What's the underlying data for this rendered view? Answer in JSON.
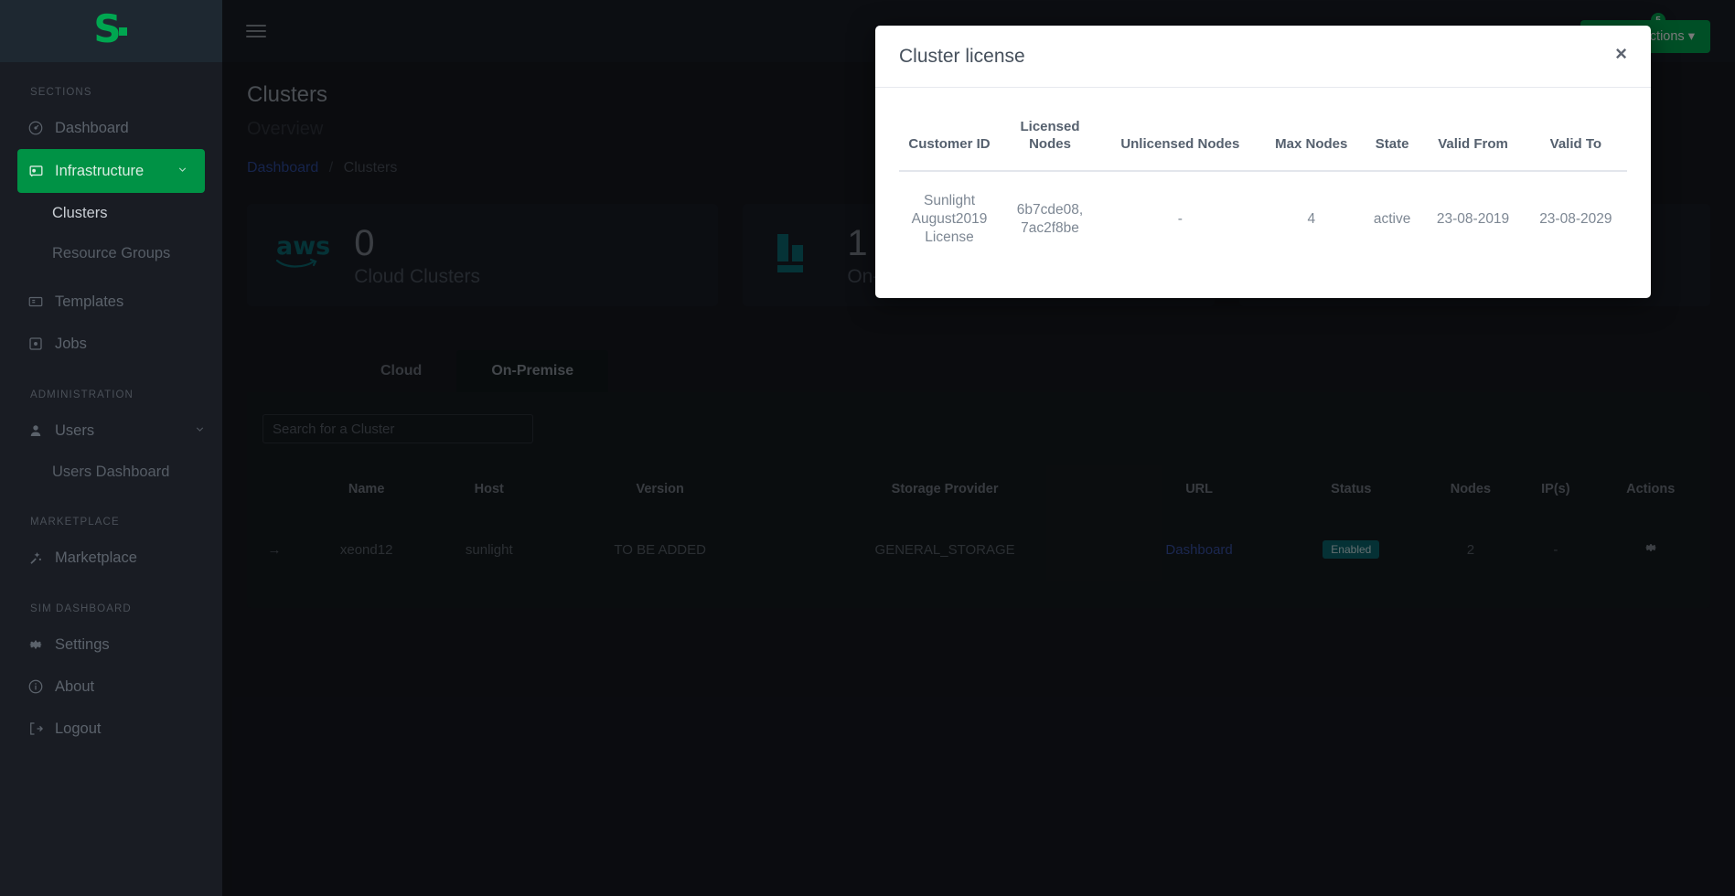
{
  "sidebar": {
    "logo": "S",
    "groups": [
      {
        "label": "SECTIONS",
        "items": [
          {
            "label": "Dashboard",
            "icon": "gauge-icon",
            "active": false,
            "children": []
          },
          {
            "label": "Infrastructure",
            "icon": "infrastructure-icon",
            "active": true,
            "children": [
              {
                "label": "Clusters",
                "current": true
              },
              {
                "label": "Resource Groups",
                "current": false
              }
            ]
          },
          {
            "label": "Templates",
            "icon": "template-icon",
            "active": false,
            "children": []
          },
          {
            "label": "Jobs",
            "icon": "jobs-icon",
            "active": false,
            "children": []
          }
        ]
      },
      {
        "label": "ADMINISTRATION",
        "items": [
          {
            "label": "Users",
            "icon": "user-icon",
            "active": false,
            "children": [
              {
                "label": "Users Dashboard",
                "current": false
              }
            ]
          }
        ]
      },
      {
        "label": "MARKETPLACE",
        "items": [
          {
            "label": "Marketplace",
            "icon": "wand-icon",
            "active": false,
            "children": []
          }
        ]
      },
      {
        "label": "SIM DASHBOARD",
        "items": [
          {
            "label": "Settings",
            "icon": "gear-icon",
            "active": false,
            "children": []
          },
          {
            "label": "About",
            "icon": "info-icon",
            "active": false,
            "children": []
          },
          {
            "label": "Logout",
            "icon": "logout-icon",
            "active": false,
            "children": []
          }
        ]
      }
    ]
  },
  "topbar": {
    "menu_icon": "hamburger-icon",
    "notifications_icon": "bell-icon",
    "notifications_count": "5",
    "account_icon": "user-avatar-icon"
  },
  "page": {
    "title": "Clusters",
    "subtitle": "Overview",
    "breadcrumb": {
      "root": "Dashboard",
      "separator": "/",
      "current": "Clusters"
    },
    "cluster_actions_label": "Cluster Actions"
  },
  "cards": [
    {
      "icon": "aws-icon",
      "value": "0",
      "label": "Cloud Clusters"
    },
    {
      "icon": "onprem-icon",
      "value": "1",
      "label": "On-Premise Clusters"
    },
    {
      "icon": "third-icon",
      "value": "",
      "label": ""
    }
  ],
  "tabs": [
    {
      "label": "Cloud",
      "selected": false
    },
    {
      "label": "On-Premise",
      "selected": true
    }
  ],
  "search": {
    "placeholder": "Search for a Cluster",
    "value": ""
  },
  "cluster_table": {
    "columns": [
      "",
      "Name",
      "Host",
      "Version",
      "Storage Provider",
      "URL",
      "Status",
      "Nodes",
      "IP(s)",
      "Actions"
    ],
    "rows": [
      {
        "arrow": "→",
        "name": "xeond12",
        "host": "sunlight",
        "version": "TO BE ADDED",
        "storage_provider": "GENERAL_STORAGE",
        "url": "Dashboard",
        "status": "Enabled",
        "nodes": "2",
        "ips": "-",
        "actions_icon": "gear-icon"
      }
    ]
  },
  "modal": {
    "title": "Cluster license",
    "close_label": "×",
    "columns": [
      "Customer ID",
      "Licensed Nodes",
      "Unlicensed Nodes",
      "Max Nodes",
      "State",
      "Valid From",
      "Valid To"
    ],
    "rows": [
      {
        "customer_id": "Sunlight August2019 License",
        "licensed_nodes": "6b7cde08, 7ac2f8be",
        "unlicensed_nodes": "-",
        "max_nodes": "4",
        "state": "active",
        "valid_from": "23-08-2019",
        "valid_to": "23-08-2029"
      }
    ]
  },
  "colors": {
    "accent_green": "#00a650",
    "sidebar_bg": "#191c23",
    "page_bg": "#171a21",
    "status_pill": "#0c6670",
    "link_blue": "#3a53a8",
    "aws_teal": "#0c6b74"
  }
}
